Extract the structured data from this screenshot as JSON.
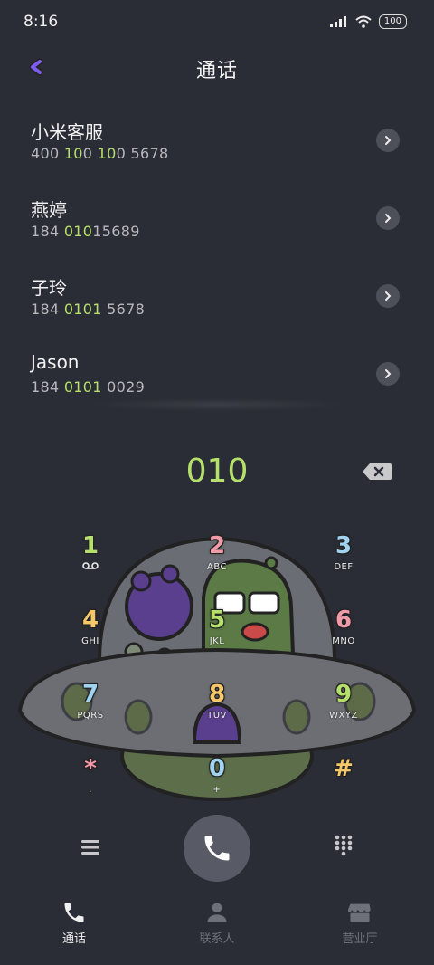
{
  "status": {
    "time": "8:16",
    "battery": "100"
  },
  "header": {
    "title": "通话"
  },
  "contacts": [
    {
      "name": "小米客服",
      "num_parts": [
        "400 ",
        "10",
        "0 ",
        "10",
        "0 5678"
      ]
    },
    {
      "name": "燕婷",
      "num_parts": [
        "184 ",
        "010",
        "15689"
      ]
    },
    {
      "name": "子玲",
      "num_parts": [
        "184 ",
        "0101",
        " 5678"
      ]
    },
    {
      "name": "Jason",
      "num_parts": [
        "184 ",
        "0101",
        " 0029"
      ]
    }
  ],
  "dialer": {
    "dialed": "010"
  },
  "keypad": [
    {
      "digit": "1",
      "letters": "",
      "color": "#b6e06c",
      "icon": "voicemail-icon"
    },
    {
      "digit": "2",
      "letters": "ABC",
      "color": "#f19aa8"
    },
    {
      "digit": "3",
      "letters": "DEF",
      "color": "#9fd3f0"
    },
    {
      "digit": "4",
      "letters": "GHI",
      "color": "#f5c86a"
    },
    {
      "digit": "5",
      "letters": "JKL",
      "color": "#b6e06c"
    },
    {
      "digit": "6",
      "letters": "MNO",
      "color": "#f19aa8"
    },
    {
      "digit": "7",
      "letters": "PQRS",
      "color": "#9fd3f0"
    },
    {
      "digit": "8",
      "letters": "TUV",
      "color": "#f5c86a"
    },
    {
      "digit": "9",
      "letters": "WXYZ",
      "color": "#b6e06c"
    },
    {
      "digit": "*",
      "letters": ",",
      "color": "#f19aa8"
    },
    {
      "digit": "0",
      "letters": "+",
      "color": "#9fd3f0"
    },
    {
      "digit": "#",
      "letters": "",
      "color": "#f5c86a"
    }
  ],
  "tabs": [
    {
      "label": "通话",
      "icon": "phone-icon",
      "active": true
    },
    {
      "label": "联系人",
      "icon": "person-icon",
      "active": false
    },
    {
      "label": "营业厅",
      "icon": "store-icon",
      "active": false
    }
  ],
  "colors": {
    "accent": "#b6e06c",
    "background": "#2b2d36",
    "back_arrow": "#7c5cf0"
  }
}
